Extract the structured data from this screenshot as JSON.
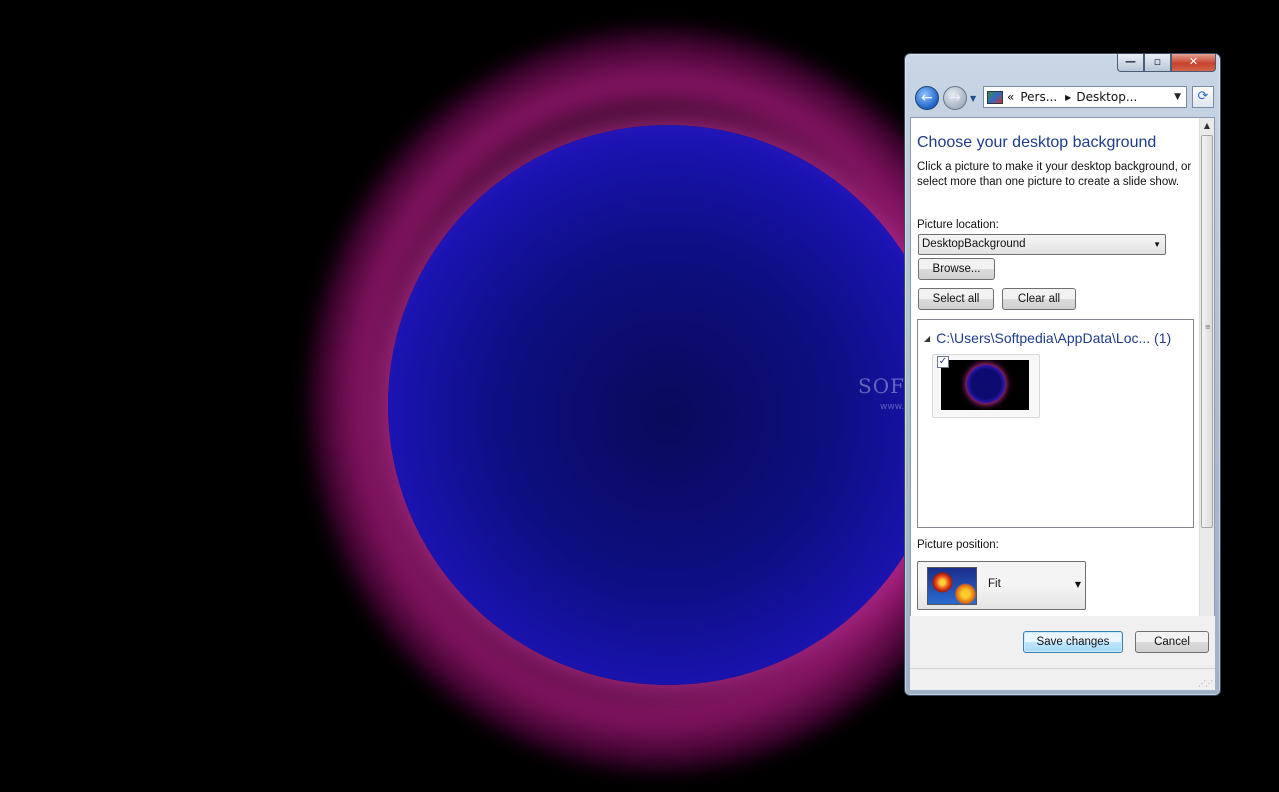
{
  "desktop": {
    "watermark": "SOFTPEDIA",
    "watermark_url": "www.softpedia.com"
  },
  "window": {
    "caption": {
      "minimize": "—",
      "maximize": "▫",
      "close": "✕"
    },
    "nav": {
      "back_glyph": "←",
      "forward_glyph": "→",
      "address_prefix": "«",
      "breadcrumb": [
        "Pers...",
        "Desktop..."
      ],
      "address_dropdown": "▼",
      "refresh_glyph": "⟳"
    },
    "heading": "Choose your desktop background",
    "description": "Click a picture to make it your desktop background, or select more than one picture to create a slide show.",
    "picture_location_label": "Picture location:",
    "picture_location_value": "DesktopBackground",
    "browse_label": "Browse...",
    "select_all_label": "Select all",
    "clear_all_label": "Clear all",
    "gallery": {
      "group_path": "C:\\Users\\Softpedia\\AppData\\Loc...",
      "group_count": "(1)",
      "items": [
        {
          "checked": true,
          "check_glyph": "✓"
        }
      ]
    },
    "picture_position_label": "Picture position:",
    "picture_position_value": "Fit",
    "save_label": "Save changes",
    "cancel_label": "Cancel"
  },
  "icons": {
    "back": "back-arrow-icon",
    "forward": "forward-arrow-icon",
    "refresh": "refresh-icon",
    "address": "control-panel-icon",
    "dropdown": "chevron-down-icon",
    "group_toggle": "collapse-triangle-icon"
  },
  "colors": {
    "heading": "#1e3c8a",
    "desktop_bg": "#000000",
    "orb_core": "#0d0e80",
    "orb_rim": "#ff5ad8"
  }
}
